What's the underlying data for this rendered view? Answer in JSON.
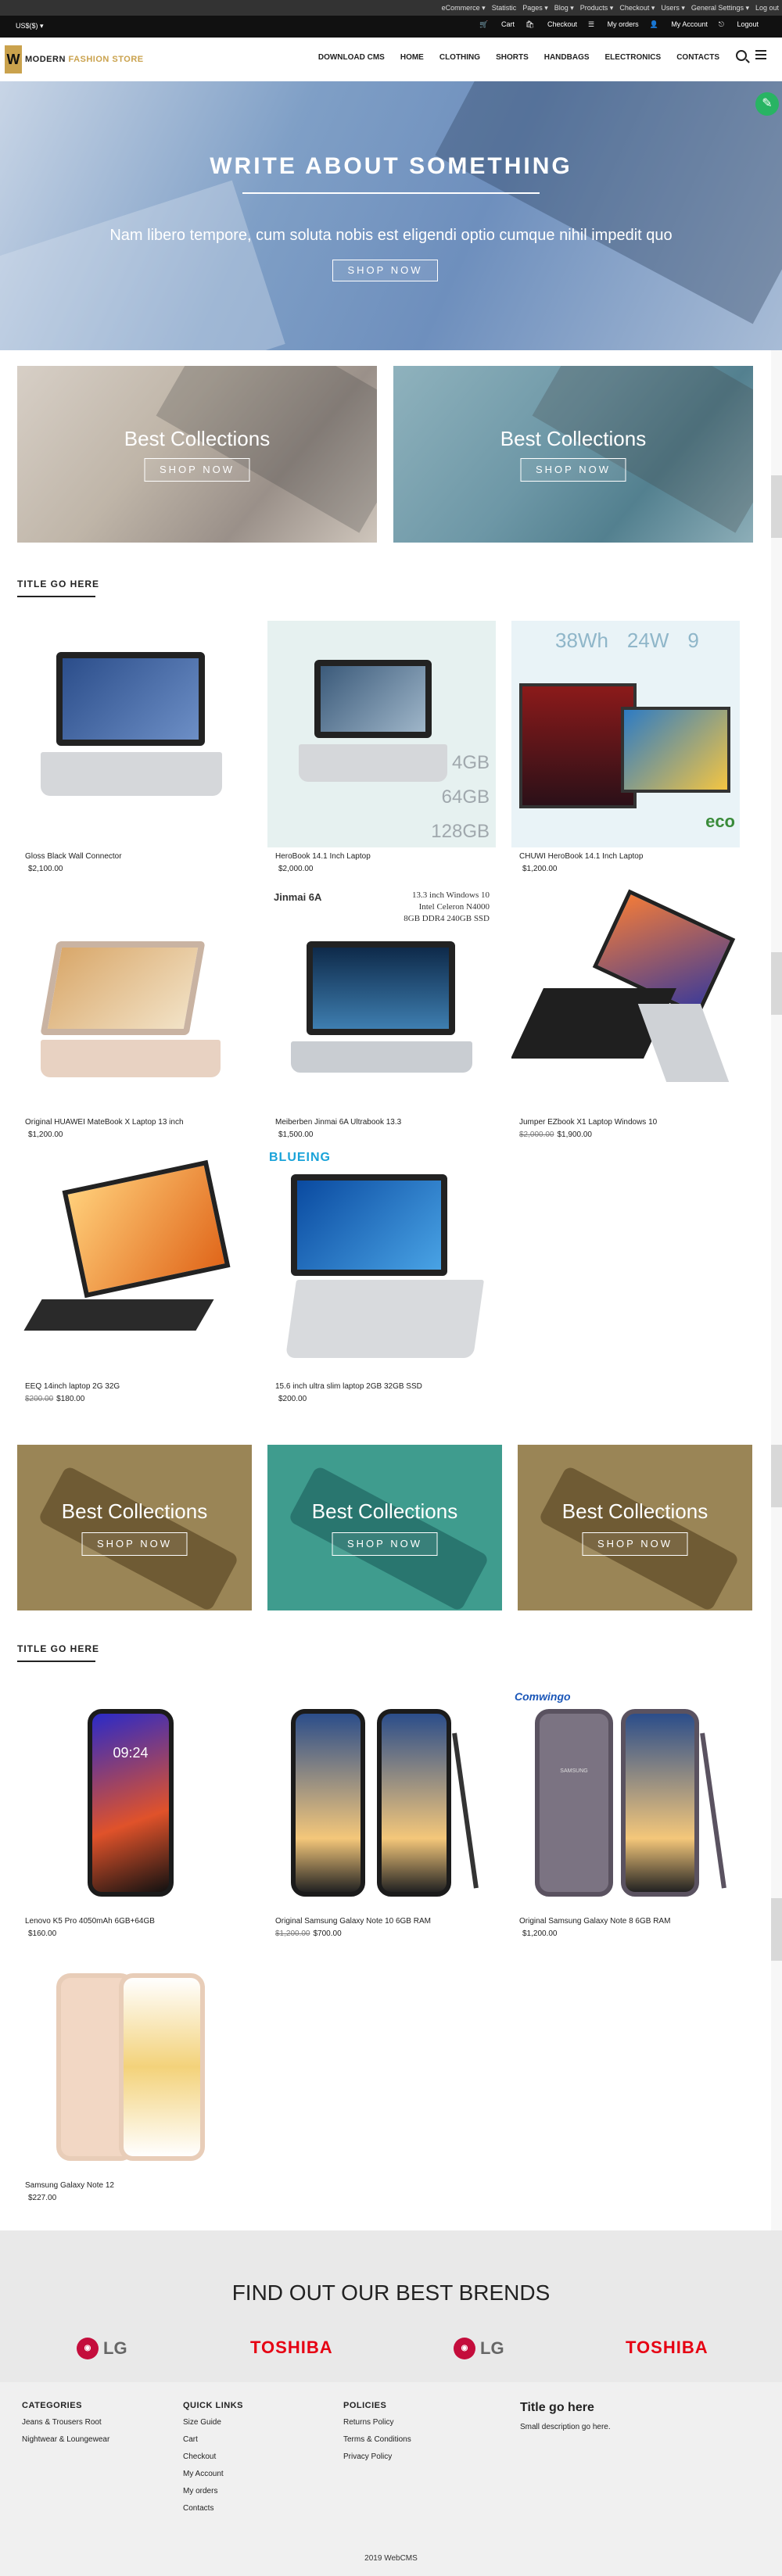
{
  "admin_bar": [
    "eCommerce ▾",
    "Statistic",
    "Pages ▾",
    "Blog ▾",
    "Products ▾",
    "Checkout ▾",
    "Users ▾",
    "General Settings ▾",
    "Log out"
  ],
  "top_bar": {
    "currency": "US$($) ▾",
    "links": [
      "Cart",
      "Checkout",
      "My orders",
      "My Account",
      "Logout"
    ]
  },
  "logo": {
    "mark": "W",
    "name_a": "MODERN ",
    "name_b": "FASHION STORE"
  },
  "nav": [
    "DOWNLOAD CMS",
    "HOME",
    "CLOTHING",
    "SHORTS",
    "HANDBAGS",
    "ELECTRONICS",
    "CONTACTS"
  ],
  "hero": {
    "title": "WRITE ABOUT SOMETHING",
    "subtitle": "Nam libero tempore, cum soluta nobis est eligendi optio cumque nihil impedit quo",
    "button": "SHOP NOW"
  },
  "banners_top": [
    {
      "title": "Best Collections",
      "button": "SHOP NOW"
    },
    {
      "title": "Best Collections",
      "button": "SHOP NOW"
    }
  ],
  "section1": {
    "title": "TITLE GO HERE",
    "products": [
      {
        "name": "Gloss Black Wall Connector",
        "price": "$2,100.00",
        "old": ""
      },
      {
        "name": "HeroBook 14.1 Inch Laptop",
        "price": "$2,000.00",
        "old": ""
      },
      {
        "name": "CHUWI HeroBook 14.1 Inch Laptop",
        "price": "$1,200.00",
        "old": ""
      },
      {
        "name": "Original HUAWEI MateBook X Laptop 13 inch",
        "price": "$1,200.00",
        "old": ""
      },
      {
        "name": "Meiberben Jinmai 6A Ultrabook 13.3",
        "price": "$1,500.00",
        "old": ""
      },
      {
        "name": "Jumper EZbook X1 Laptop Windows 10",
        "price": "$1,900.00",
        "old": "$2,000.00"
      },
      {
        "name": "EEQ 14inch laptop 2G 32G",
        "price": "$180.00",
        "old": "$200.00"
      },
      {
        "name": "15.6 inch ultra slim laptop 2GB 32GB SSD",
        "price": "$200.00",
        "old": ""
      }
    ]
  },
  "banners_mid": [
    {
      "title": "Best Collections",
      "button": "SHOP NOW"
    },
    {
      "title": "Best Collections",
      "button": "SHOP NOW"
    },
    {
      "title": "Best Collections",
      "button": "SHOP NOW"
    }
  ],
  "section2": {
    "title": "TITLE GO HERE",
    "products": [
      {
        "name": "Lenovo K5 Pro 4050mAh 6GB+64GB",
        "price": "$160.00",
        "old": ""
      },
      {
        "name": "Original Samsung Galaxy Note 10 6GB RAM",
        "price": "$700.00",
        "old": "$1,200.00"
      },
      {
        "name": "Original Samsung Galaxy Note 8 6GB RAM",
        "price": "$1,200.00",
        "old": ""
      },
      {
        "name": "Samsung Galaxy Note 12",
        "price": "$227.00",
        "old": ""
      }
    ]
  },
  "product_image_text": {
    "p2_specs": [
      "4GB",
      "64GB",
      "128GB"
    ],
    "p3_specs": [
      "38Wh",
      "24W",
      "9"
    ],
    "p3_brand": "eco",
    "p5_brand": "Jinmai 6A",
    "p5_specs": [
      "13.3 inch Windows 10",
      "Intel Celeron N4000",
      "8GB DDR4 240GB SSD"
    ],
    "p8_brand": "BLUEING",
    "p9_time": "09:24",
    "p11_brand": "Comwingo",
    "p11_model": "SAMSUNG"
  },
  "brands": {
    "title": "FIND OUT OUR BEST BRENDS",
    "items": [
      "LG",
      "TOSHIBA",
      "LG",
      "TOSHIBA"
    ]
  },
  "footer": {
    "categories": {
      "heading": "CATEGORIES",
      "links": [
        "Jeans & Trousers Root",
        "Nightwear & Loungewear"
      ]
    },
    "quick_links": {
      "heading": "QUICK LINKS",
      "links": [
        "Size Guide",
        "Cart",
        "Checkout",
        "My Account",
        "My orders",
        "Contacts"
      ]
    },
    "policies": {
      "heading": "POLICIES",
      "links": [
        "Returns Policy",
        "Terms & Conditions",
        "Privacy Policy"
      ]
    },
    "about": {
      "heading": "Title go here",
      "text": "Small description go here."
    },
    "copyright": "2019 WebCMS"
  },
  "colors": {
    "accent": "#caa24d",
    "edit_button": "#28b463",
    "lg_red": "#c40d3c",
    "toshiba_red": "#e60012",
    "banner_gold": "#9a8556",
    "banner_teal": "#3f9c8e"
  }
}
